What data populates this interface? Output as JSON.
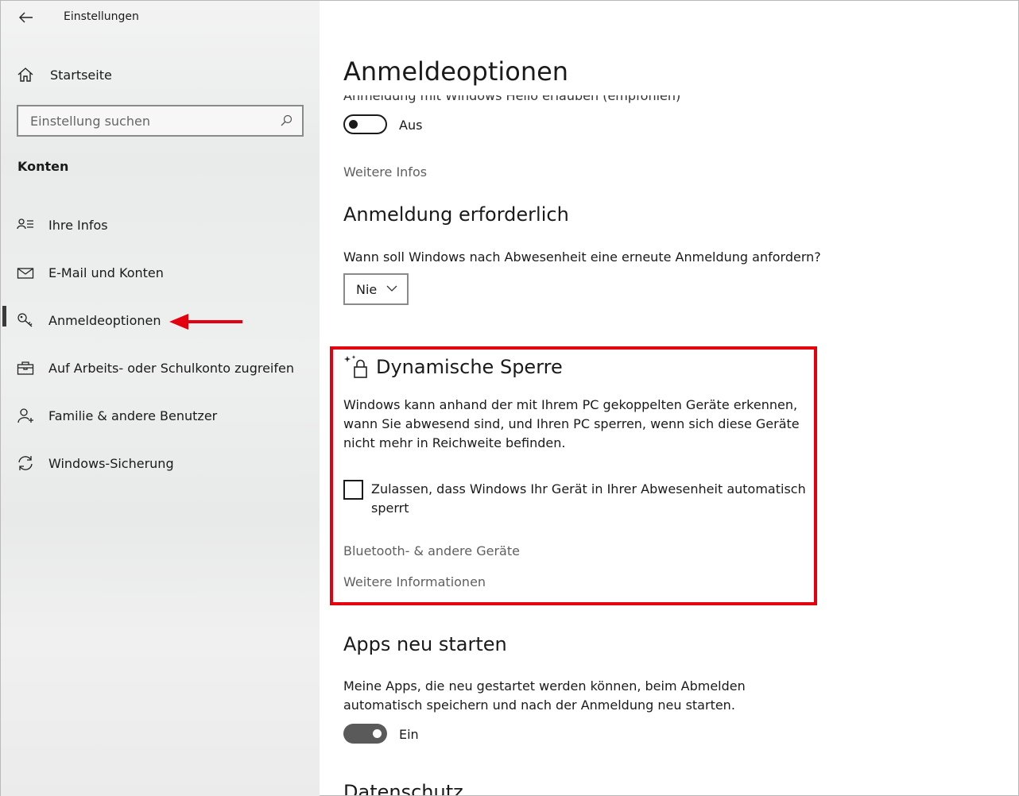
{
  "window": {
    "title": "Einstellungen",
    "controls": [
      "minimize",
      "maximize",
      "close"
    ]
  },
  "sidebar": {
    "home_label": "Startseite",
    "search_placeholder": "Einstellung suchen",
    "section_heading": "Konten",
    "items": [
      {
        "label": "Ihre Infos",
        "icon": "contact-card-icon"
      },
      {
        "label": "E-Mail und Konten",
        "icon": "mail-icon"
      },
      {
        "label": "Anmeldeoptionen",
        "icon": "key-icon",
        "selected": true
      },
      {
        "label": "Auf Arbeits- oder Schulkonto zugreifen",
        "icon": "briefcase-icon"
      },
      {
        "label": "Familie & andere Benutzer",
        "icon": "add-person-icon"
      },
      {
        "label": "Windows-Sicherung",
        "icon": "sync-icon"
      }
    ],
    "annotation_arrow_color": "#e3000f"
  },
  "main": {
    "page_title": "Anmeldeoptionen",
    "hello_cut_text": "Anmeldung mit Windows Hello erlauben (empfohlen)",
    "hello_toggle": {
      "state": "off",
      "label": "Aus"
    },
    "more_info_link": "Weitere Infos",
    "signin_required": {
      "heading": "Anmeldung erforderlich",
      "question": "Wann soll Windows nach Abwesenheit eine erneute Anmeldung anfordern?",
      "dropdown_value": "Nie"
    },
    "dynamic_lock": {
      "heading": "Dynamische Sperre",
      "description_line1": "Windows kann anhand der mit Ihrem PC gekoppelten Geräte erkennen,",
      "description_line2": "wann Sie abwesend sind, und Ihren PC sperren, wenn sich diese Geräte",
      "description_line3": "nicht mehr in Reichweite befinden.",
      "checkbox_line1": "Zulassen, dass Windows Ihr Gerät in Ihrer Abwesenheit automatisch",
      "checkbox_line2": "sperrt",
      "checkbox_checked": false,
      "bluetooth_link": "Bluetooth- & andere Geräte",
      "more_info_link": "Weitere Informationen",
      "highlight_color": "#e3000f"
    },
    "restart_apps": {
      "heading": "Apps neu starten",
      "description_line1": "Meine Apps, die neu gestartet werden können, beim Abmelden",
      "description_line2": "automatisch speichern und nach der Anmeldung neu starten.",
      "toggle": {
        "state": "on",
        "label": "Ein"
      }
    },
    "privacy_heading": "Datenschutz"
  }
}
